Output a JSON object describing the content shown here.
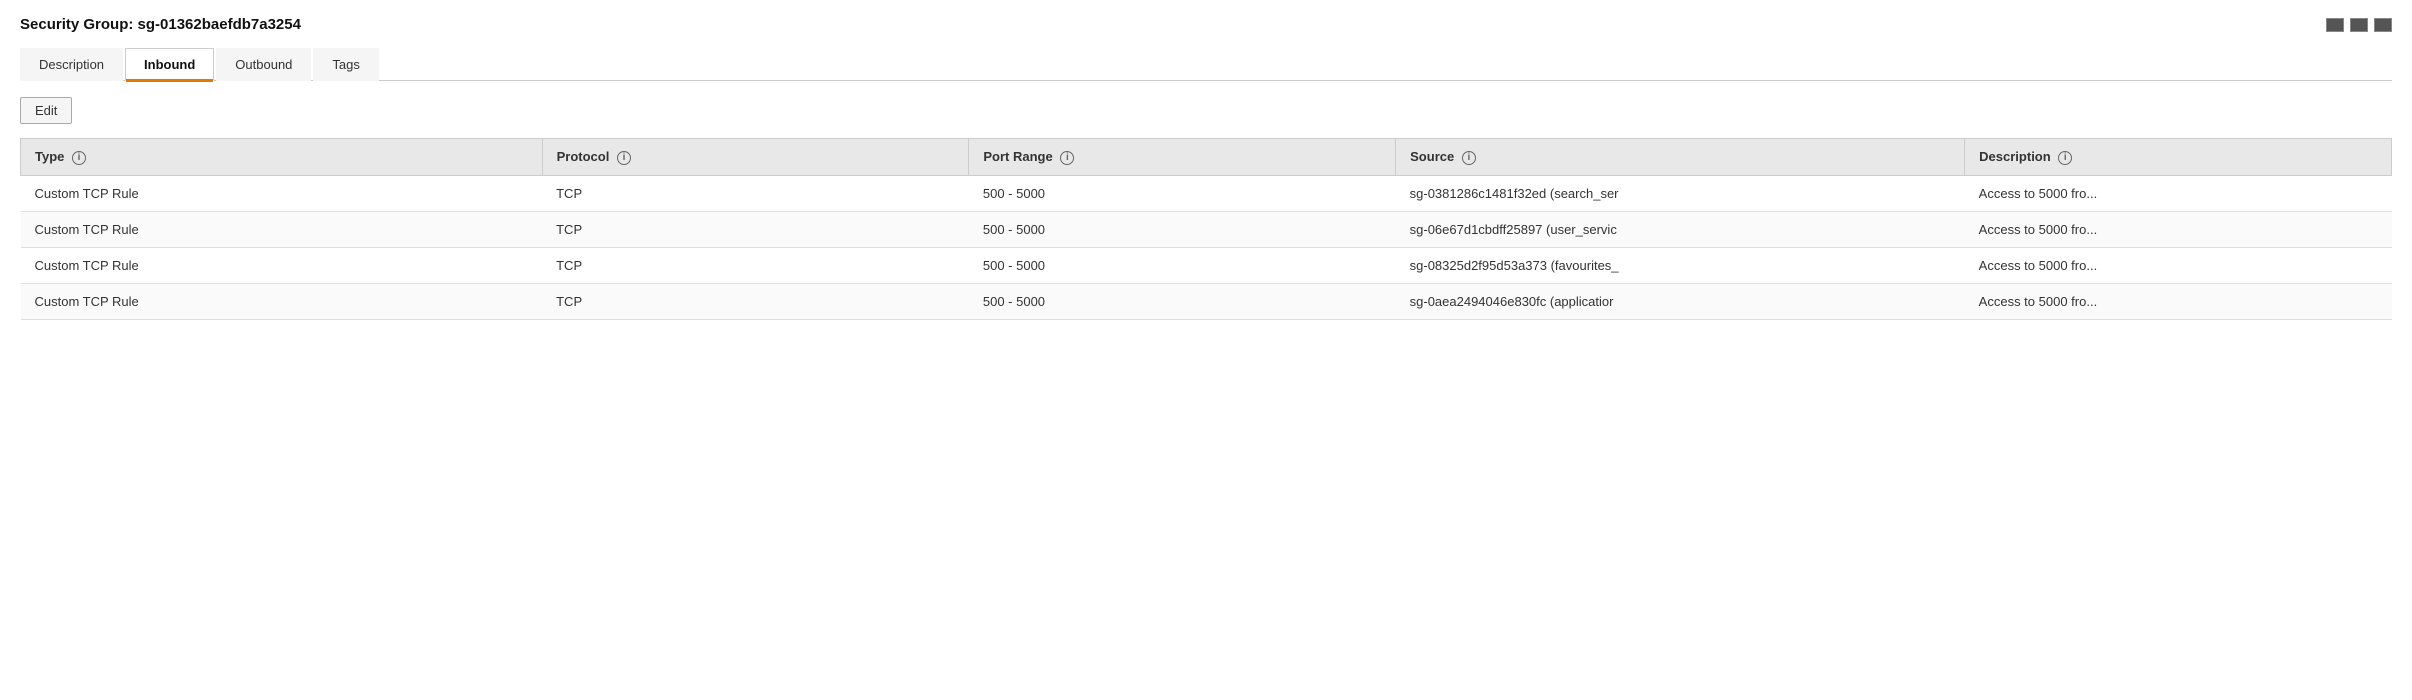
{
  "header": {
    "title": "Security Group: sg-01362baefdb7a3254",
    "window_controls": [
      "maximize",
      "restore",
      "minimize"
    ]
  },
  "tabs": [
    {
      "id": "description",
      "label": "Description",
      "active": false
    },
    {
      "id": "inbound",
      "label": "Inbound",
      "active": true
    },
    {
      "id": "outbound",
      "label": "Outbound",
      "active": false
    },
    {
      "id": "tags",
      "label": "Tags",
      "active": false
    }
  ],
  "edit_button": "Edit",
  "table": {
    "columns": [
      {
        "id": "type",
        "label": "Type"
      },
      {
        "id": "protocol",
        "label": "Protocol"
      },
      {
        "id": "port_range",
        "label": "Port Range"
      },
      {
        "id": "source",
        "label": "Source"
      },
      {
        "id": "description",
        "label": "Description"
      }
    ],
    "rows": [
      {
        "type": "Custom TCP Rule",
        "protocol": "TCP",
        "port_range": "500 - 5000",
        "source": "sg-0381286c1481f32ed (search_ser",
        "description": "Access to 5000 fro..."
      },
      {
        "type": "Custom TCP Rule",
        "protocol": "TCP",
        "port_range": "500 - 5000",
        "source": "sg-06e67d1cbdff25897 (user_servic",
        "description": "Access to 5000 fro..."
      },
      {
        "type": "Custom TCP Rule",
        "protocol": "TCP",
        "port_range": "500 - 5000",
        "source": "sg-08325d2f95d53a373 (favourites_",
        "description": "Access to 5000 fro..."
      },
      {
        "type": "Custom TCP Rule",
        "protocol": "TCP",
        "port_range": "500 - 5000",
        "source": "sg-0aea2494046e830fc (applicatior",
        "description": "Access to 5000 fro..."
      }
    ]
  }
}
